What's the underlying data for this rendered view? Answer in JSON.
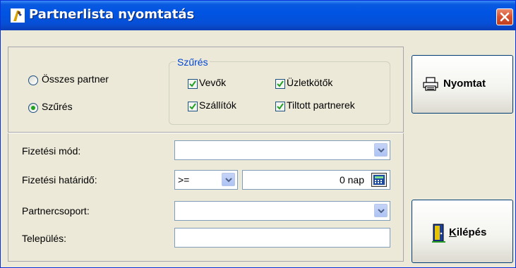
{
  "window": {
    "title": "Partnerlista nyomtatás"
  },
  "scope": {
    "option_all": "Összes partner",
    "option_filter": "Szűrés",
    "selected": "Szűrés"
  },
  "filter_group": {
    "title": "Szűrés",
    "items": [
      {
        "label": "Vevők",
        "checked": true
      },
      {
        "label": "Üzletkötők",
        "checked": true
      },
      {
        "label": "Szállítók",
        "checked": true
      },
      {
        "label": "Tiltott partnerek",
        "checked": true
      }
    ]
  },
  "form": {
    "payment_method_label": "Fizetési mód:",
    "payment_method_value": "",
    "deadline_label": "Fizetési határidő:",
    "deadline_operator": ">=",
    "deadline_value": "0 nap",
    "partner_group_label": "Partnercsoport:",
    "partner_group_value": "",
    "settlement_label": "Település:",
    "settlement_value": ""
  },
  "buttons": {
    "print_label": "Nyomtat",
    "exit_label": "Kilépés"
  }
}
